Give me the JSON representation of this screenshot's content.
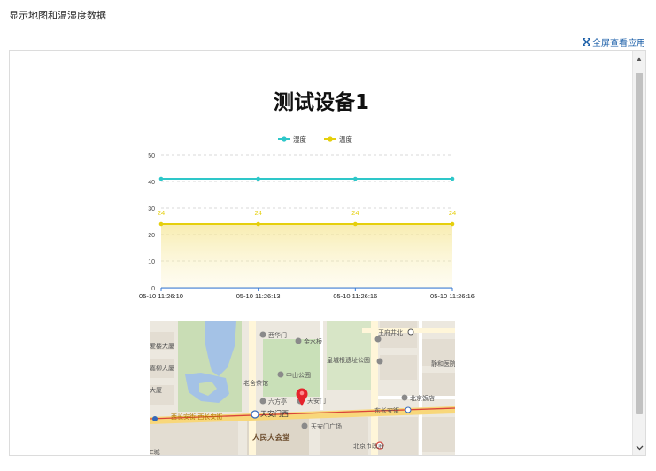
{
  "page": {
    "title": "显示地图和温湿度数据",
    "fullscreen_label": "全屏查看应用",
    "accent": "#1a5ea8"
  },
  "device": {
    "name": "测试设备1"
  },
  "chart_data": {
    "type": "line",
    "title": "测试设备1",
    "x": [
      "05-10 11:26:10",
      "05-10 11:26:13",
      "05-10 11:26:16",
      "05-10 11:26:16"
    ],
    "series": [
      {
        "name": "湿度",
        "values": [
          41,
          41,
          41,
          41
        ],
        "color": "#2ec7c9",
        "labels": false
      },
      {
        "name": "温度",
        "values": [
          24,
          24,
          24,
          24
        ],
        "color": "#e5cf0d",
        "labels": true,
        "area": true
      }
    ],
    "ylim": [
      0,
      50
    ],
    "yticks": [
      0,
      10,
      20,
      30,
      40,
      50
    ],
    "grid": true,
    "legend": "top-center"
  },
  "map": {
    "labels": {
      "xihuamen": "西华门",
      "jinshuiqiao": "金水桥",
      "wangfujing": "王府井北",
      "huangchenggen": "皇城根遗址公园",
      "zhongshan": "中山公园",
      "laoshe": "老舍茶馆",
      "jiehe": "静和医院",
      "tiananmen_square": "天安门",
      "tiananmen_west": "天安门西",
      "tiananmen_west_station": "天安门西",
      "dongchangan": "东长安街",
      "xichangan": "西长安街",
      "xichangan_line": "西长安街-西长安街",
      "great_hall": "人民大会堂",
      "guangchang": "天安门广场",
      "beijing_hotel": "北京饭店",
      "beijing_gov": "北京市政府",
      "daliuta": "六方亭",
      "lhuizhou": "爱楼大厦",
      "dasha": "大厦",
      "liuzhou": "嘉柳大厦",
      "edge": "E城"
    }
  }
}
